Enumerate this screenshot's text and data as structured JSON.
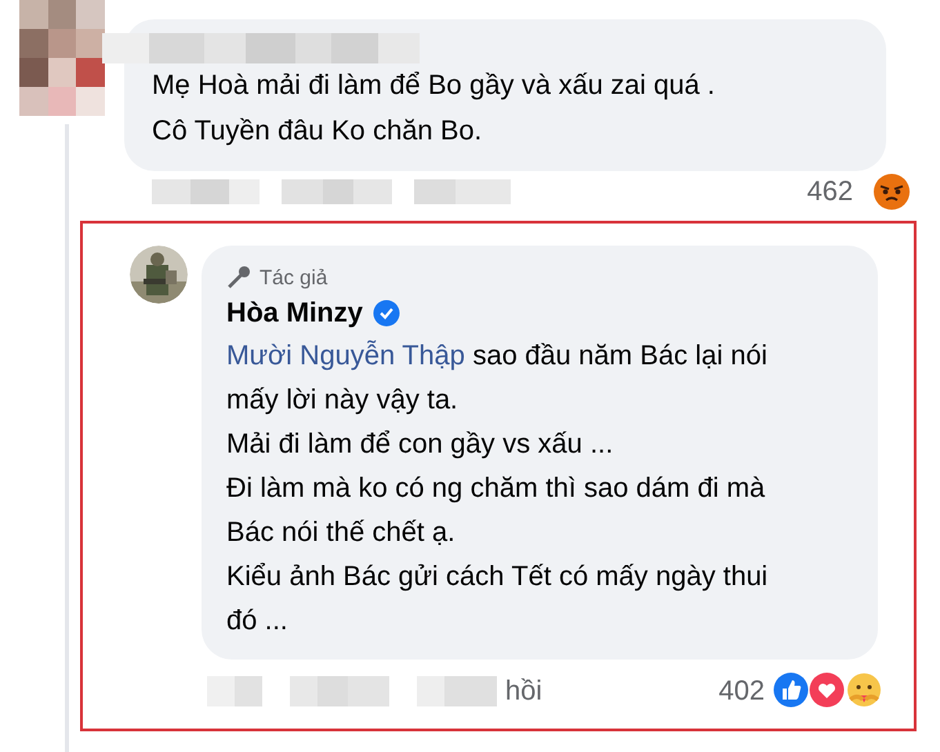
{
  "comment": {
    "text_lines": [
      "Mẹ Hoà mải đi làm để Bo gầy và xấu zai quá .",
      "Cô Tuyền đâu Ko chăn Bo."
    ],
    "reaction_count": "462"
  },
  "reply": {
    "badge": "Tác giả",
    "author": "Hòa Minzy",
    "verified": true,
    "mention": "Mười Nguyễn Thập",
    "paragraphs": [
      " sao đầu năm Bác lại nói mấy lời này vậy ta.",
      "Mải đi làm để con gầy vs xấu ...",
      "Đi làm mà ko có ng chăm thì sao dám đi mà Bác nói thế chết ạ.",
      "Kiểu ảnh Bác gửi cách Tết có mấy ngày thui đó ..."
    ],
    "action_tail": "hồi",
    "reaction_count": "402"
  }
}
